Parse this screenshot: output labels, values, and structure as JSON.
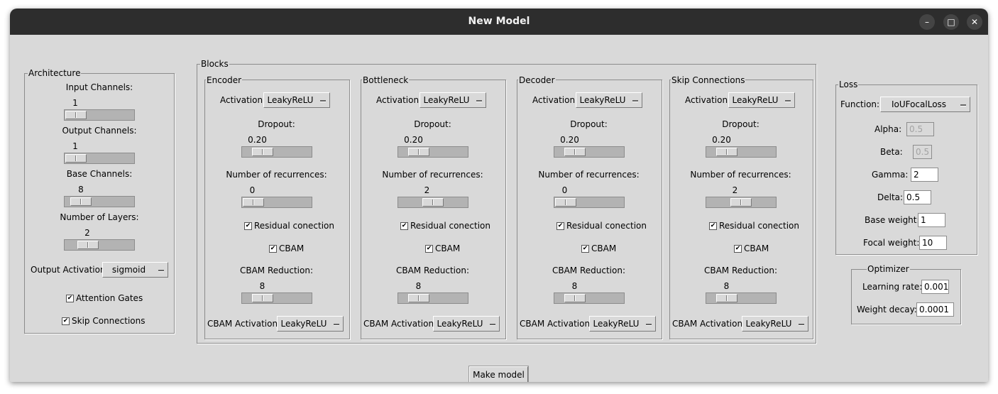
{
  "window": {
    "title": "New Model",
    "controls": [
      "–",
      "□",
      "✕"
    ]
  },
  "architecture": {
    "legend": "Architecture",
    "input_channels": {
      "label": "Input Channels:",
      "value": "1",
      "level": 0
    },
    "output_channels": {
      "label": "Output Channels:",
      "value": "1",
      "level": 0
    },
    "base_channels": {
      "label": "Base Channels:",
      "value": "8",
      "level": 0.1
    },
    "num_layers": {
      "label": "Number of Layers:",
      "value": "2",
      "level": 0.25
    },
    "output_activation": {
      "label": "Output Activation:",
      "value": "sigmoid"
    },
    "attention_gates": {
      "label": "Attention Gates",
      "checked": true
    },
    "skip_connections": {
      "label": "Skip Connections",
      "checked": true
    }
  },
  "blocks": {
    "legend": "Blocks",
    "common_labels": {
      "activation": "Activation:",
      "dropout": "Dropout:",
      "recurrences": "Number of recurrences:",
      "residual": "Residual conection",
      "cbam": "CBAM",
      "cbam_reduction": "CBAM Reduction:",
      "cbam_activation": "CBAM Activation:"
    },
    "items": [
      {
        "name": "Encoder",
        "activation": "LeakyReLU",
        "dropout": "0.20",
        "dropout_level": 0.2,
        "recurrences": "0",
        "rec_level": 0,
        "residual": true,
        "cbam": true,
        "cbam_reduction": "8",
        "red_level": 0.2,
        "cbam_activation": "LeakyReLU"
      },
      {
        "name": "Bottleneck",
        "activation": "LeakyReLU",
        "dropout": "0.20",
        "dropout_level": 0.2,
        "recurrences": "2",
        "rec_level": 0.5,
        "residual": true,
        "cbam": true,
        "cbam_reduction": "8",
        "red_level": 0.2,
        "cbam_activation": "LeakyReLU"
      },
      {
        "name": "Decoder",
        "activation": "LeakyReLU",
        "dropout": "0.20",
        "dropout_level": 0.2,
        "recurrences": "0",
        "rec_level": 0,
        "residual": true,
        "cbam": true,
        "cbam_reduction": "8",
        "red_level": 0.2,
        "cbam_activation": "LeakyReLU"
      },
      {
        "name": "Skip Connections",
        "activation": "LeakyReLU",
        "dropout": "0.20",
        "dropout_level": 0.2,
        "recurrences": "2",
        "rec_level": 0.5,
        "residual": true,
        "cbam": true,
        "cbam_reduction": "8",
        "red_level": 0.2,
        "cbam_activation": "LeakyReLU"
      }
    ]
  },
  "loss": {
    "legend": "Loss",
    "function_label": "Function:",
    "function": "IoUFocalLoss",
    "alpha": {
      "label": "Alpha:",
      "value": "0.5",
      "disabled": true
    },
    "beta": {
      "label": "Beta:",
      "value": "0.5",
      "disabled": true
    },
    "gamma": {
      "label": "Gamma:",
      "value": "2"
    },
    "delta": {
      "label": "Delta:",
      "value": "0.5"
    },
    "base_weight": {
      "label": "Base weight:",
      "value": "1"
    },
    "focal_weight": {
      "label": "Focal weight:",
      "value": "10"
    }
  },
  "optimizer": {
    "legend": "Optimizer",
    "learning_rate": {
      "label": "Learning rate:",
      "value": "0.001"
    },
    "weight_decay": {
      "label": "Weight decay:",
      "value": "0.0001"
    }
  },
  "actions": {
    "make_model": "Make model"
  }
}
